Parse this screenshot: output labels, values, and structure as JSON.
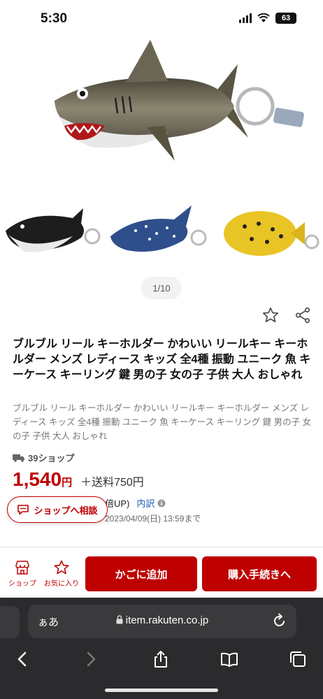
{
  "status": {
    "time": "5:30",
    "battery": "63"
  },
  "gallery": {
    "counter": "1/10"
  },
  "product": {
    "title": "ブルブル リール キーホルダー かわいい リールキー キーホルダー メンズ レディース キッズ 全4種 振動 ユニーク 魚 キーケース キーリング 鍵 男の子 女の子 子供 大人 おしゃれ",
    "subtitle": "ブルブル リール キーホルダー かわいい リールキー キーホルダー メンズ レディース キッズ 全4種 振動 ユニーク 魚 キーケース キーリング 鍵 男の子 女の子 子供 大人 おしゃれ",
    "shop": "39ショップ",
    "price": "1,540",
    "yen": "円",
    "shipping": "＋送料750円",
    "points_text": "倍UP)",
    "breakdown": "内訳",
    "deadline": "2023/04/09(日) 13:59まで"
  },
  "consult_button": "ショップへ相談",
  "bottom_nav": {
    "shop": "ショップ",
    "favorite": "お気に入り",
    "add_to_cart": "かごに追加",
    "checkout": "購入手続きへ"
  },
  "browser": {
    "aa": "ぁあ",
    "url": "item.rakuten.co.jp"
  },
  "colors": {
    "accent": "#bf0000",
    "link": "#1a5fb4"
  }
}
